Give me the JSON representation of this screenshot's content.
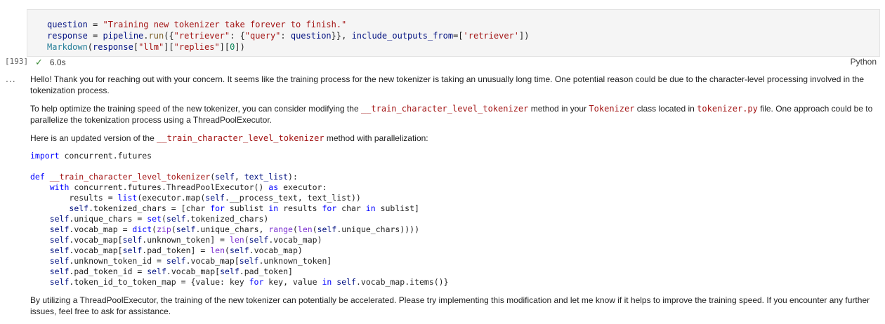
{
  "input_cell": {
    "execution_count": "[193]",
    "duration": "6.0s",
    "language": "Python"
  },
  "output": {
    "toolbar": "...",
    "p1": "Hello! Thank you for reaching out with your concern. It seems like the training process for the new tokenizer is taking an unusually long time. One potential reason could be due to the character-level processing involved in the tokenization process.",
    "p2_a": "To help optimize the training speed of the new tokenizer, you can consider modifying the ",
    "p2_code1": "__train_character_level_tokenizer",
    "p2_b": " method in your ",
    "p2_code2": "Tokenizer",
    "p2_c": " class located in ",
    "p2_code3": "tokenizer.py",
    "p2_d": " file. One approach could be to parallelize the tokenization process using a ThreadPoolExecutor.",
    "p3_a": "Here is an updated version of the ",
    "p3_code": "__train_character_level_tokenizer",
    "p3_b": " method with parallelization:",
    "p4": "By utilizing a ThreadPoolExecutor, the training of the new tokenizer can potentially be accelerated. Please try implementing this modification and let me know if it helps to improve the training speed. If you encounter any further issues, feel free to ask for assistance."
  },
  "icons": {
    "success": "check-icon",
    "more": "ellipsis-icon"
  },
  "colors": {
    "success": "#388a34",
    "keyword": "#0000ff",
    "string": "#a31515",
    "variable": "#001080"
  }
}
